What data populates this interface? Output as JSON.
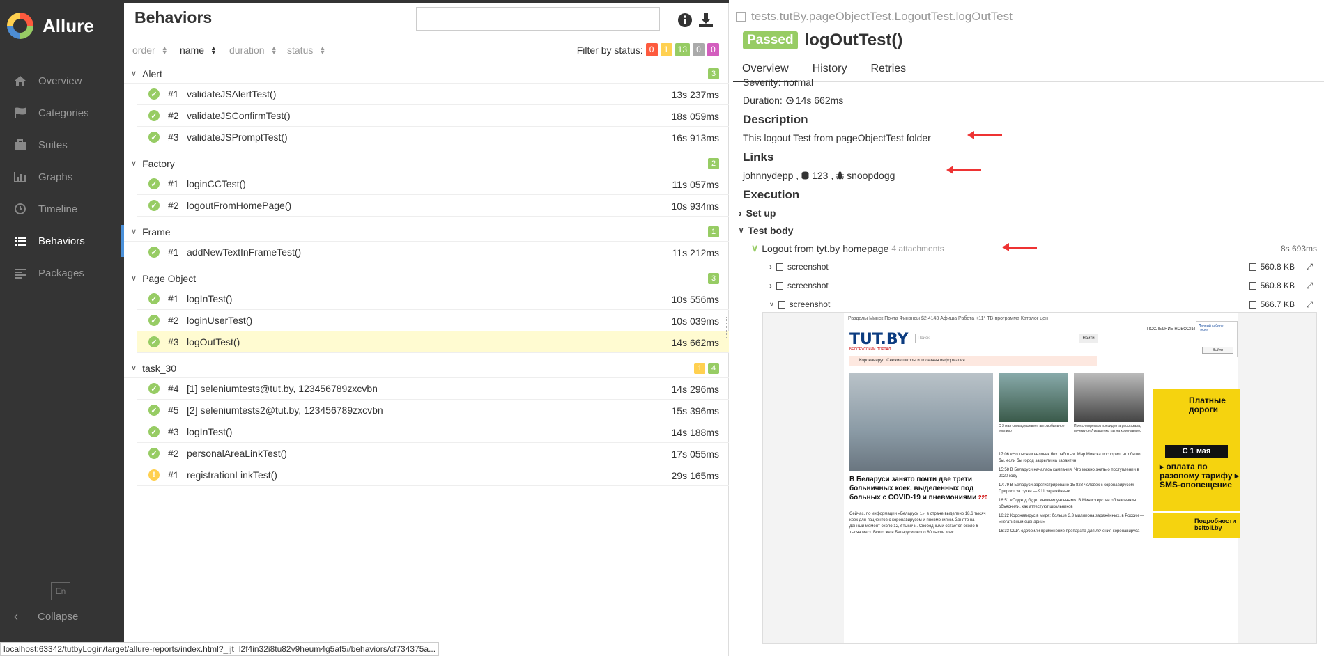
{
  "sidebar": {
    "logo": "Allure",
    "items": [
      {
        "label": "Overview",
        "icon": "home-icon"
      },
      {
        "label": "Categories",
        "icon": "flag-icon"
      },
      {
        "label": "Suites",
        "icon": "briefcase-icon"
      },
      {
        "label": "Graphs",
        "icon": "bar-chart-icon"
      },
      {
        "label": "Timeline",
        "icon": "clock-icon"
      },
      {
        "label": "Behaviors",
        "icon": "list-icon",
        "active": true
      },
      {
        "label": "Packages",
        "icon": "align-left-icon"
      }
    ],
    "language": "En",
    "collapse": "Collapse"
  },
  "left": {
    "title": "Behaviors",
    "search_value": "",
    "sort": {
      "order": "order",
      "name": "name",
      "duration": "duration",
      "status": "status"
    },
    "filter_label": "Filter by status:",
    "filter_counts": [
      "0",
      "1",
      "13",
      "0",
      "0"
    ],
    "groups": [
      {
        "name": "Alert",
        "counts": [
          {
            "v": "3",
            "c": "#97cc64"
          }
        ],
        "tests": [
          {
            "num": "#1",
            "name": "validateJSAlertTest()",
            "dur": "13s 237ms",
            "status": "passed"
          },
          {
            "num": "#2",
            "name": "validateJSConfirmTest()",
            "dur": "18s 059ms",
            "status": "passed"
          },
          {
            "num": "#3",
            "name": "validateJSPromptTest()",
            "dur": "16s 913ms",
            "status": "passed"
          }
        ]
      },
      {
        "name": "Factory",
        "counts": [
          {
            "v": "2",
            "c": "#97cc64"
          }
        ],
        "tests": [
          {
            "num": "#1",
            "name": "loginCCTest()",
            "dur": "11s 057ms",
            "status": "passed"
          },
          {
            "num": "#2",
            "name": "logoutFromHomePage()",
            "dur": "10s 934ms",
            "status": "passed"
          }
        ]
      },
      {
        "name": "Frame",
        "counts": [
          {
            "v": "1",
            "c": "#97cc64"
          }
        ],
        "tests": [
          {
            "num": "#1",
            "name": "addNewTextInFrameTest()",
            "dur": "11s 212ms",
            "status": "passed"
          }
        ]
      },
      {
        "name": "Page Object",
        "counts": [
          {
            "v": "3",
            "c": "#97cc64"
          }
        ],
        "tests": [
          {
            "num": "#1",
            "name": "logInTest()",
            "dur": "10s 556ms",
            "status": "passed"
          },
          {
            "num": "#2",
            "name": "loginUserTest()",
            "dur": "10s 039ms",
            "status": "passed"
          },
          {
            "num": "#3",
            "name": "logOutTest()",
            "dur": "14s 662ms",
            "status": "passed",
            "selected": true
          }
        ]
      },
      {
        "name": "task_30",
        "counts": [
          {
            "v": "1",
            "c": "#ffd050"
          },
          {
            "v": "4",
            "c": "#97cc64"
          }
        ],
        "tests": [
          {
            "num": "#4",
            "name": "[1] seleniumtests@tut.by, 123456789zxcvbn",
            "dur": "14s 296ms",
            "status": "passed"
          },
          {
            "num": "#5",
            "name": "[2] seleniumtests2@tut.by, 123456789zxcvbn",
            "dur": "15s 396ms",
            "status": "passed"
          },
          {
            "num": "#3",
            "name": "logInTest()",
            "dur": "14s 188ms",
            "status": "passed"
          },
          {
            "num": "#2",
            "name": "personalAreaLinkTest()",
            "dur": "17s 055ms",
            "status": "passed"
          },
          {
            "num": "#1",
            "name": "registrationLinkTest()",
            "dur": "29s 165ms",
            "status": "broken"
          }
        ]
      }
    ]
  },
  "right": {
    "path": "tests.tutBy.pageObjectTest.LogoutTest.logOutTest",
    "status": "Passed",
    "test_name": "logOutTest()",
    "tabs": [
      "Overview",
      "History",
      "Retries"
    ],
    "severity_label": "Severity:",
    "severity": "normal",
    "duration_label": "Duration:",
    "duration": "14s 662ms",
    "description_title": "Description",
    "description": "This logout Test from pageObjectTest folder",
    "links_title": "Links",
    "link1": "johnnydepp",
    "link2": "123",
    "link3": "snoopdogg",
    "execution_title": "Execution",
    "setup": "Set up",
    "test_body": "Test body",
    "step": "Logout from tyt.by homepage",
    "step_attachments": "4 attachments",
    "step_duration": "8s 693ms",
    "attachments": [
      {
        "label": "screenshot",
        "size": "560.8 KB"
      },
      {
        "label": "screenshot",
        "size": "560.8 KB"
      },
      {
        "label": "screenshot",
        "size": "566.7 KB"
      }
    ]
  },
  "embed": {
    "nav": "Разделы   Минск   Почта   Финансы $2.4143   Афиша   Работа   +11°   ТВ-программа   Каталог цен",
    "logo": "TUT.BY",
    "logo_sub": "БЕЛОРУССКИЙ ПОРТАЛ",
    "search_placeholder": "Поиск",
    "search_button": "Найти",
    "covid_banner": "Коронавирус. Свежие цифры и полезная информация",
    "hero_title": "В Беларуси занято почти две трети больничных коек, выделенных под больных с COVID-19 и пневмониями",
    "hero_count": "220",
    "hero_text": "Сейчас, по информации «Беларусь 1», в стране выделено 18,6 тысяч коек для пациентов с коронавирусом и пневмониями. Занято на данный момент около 12,8 тысячи. Свободными остается около 6 тысяч мест. Всего же в Беларуси около 80 тысяч коек.",
    "news": [
      "17:06 «Но тысячи человек без работы». Мэр Минска поспорил, что было бы, если бы город закрыли на карантин",
      "15:58 В Беларуси началась кампания. Что можно знать о поступлении в 2020 году",
      "17:79 В Беларуси зарегистрировано 15 828 человек с коронавирусом. Прирост за сутки — 911 заражённых",
      "16:51 «Подход будет индивидуальным». В Министерстве образования объяснили, как аттестуют школьников",
      "16:22 Коронавирус в мире: больше 3,3 миллиона заражённых, в России — «негативный сценарий»",
      "16:33 США одобрили применение препарата для лечения коронавируса"
    ],
    "thumb_caption_1": "С 3 мая снова дешевеет автомобильное топливо",
    "thumb_caption_2": "Пресс-секретарь президента рассказала, почему он Лукашенко так на коронавирус",
    "side_head": "ПОСЛЕДНИЕ НОВОСТИ",
    "ad_line1": "Платные дороги",
    "ad_date": "С 1 мая",
    "ad_line2": "▸ оплата по разовому тарифу ▸ SMS-оповещение",
    "ad_brand": "Подробности beltoll.by",
    "popup_title": "Личный кабинет",
    "popup_mail": "Почта",
    "popup_logout": "Выйти"
  },
  "statusbar": "localhost:63342/tutbyLogin/target/allure-reports/index.html?_ijt=l2f4in32i8tu82v9heum4g5af5#behaviors/cf734375a..."
}
